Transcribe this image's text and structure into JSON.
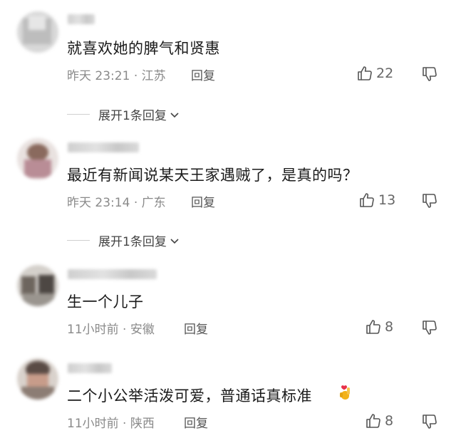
{
  "comments": [
    {
      "text": "就喜欢她的脾气和贤惠",
      "time": "昨天 23:21",
      "location": "江苏",
      "reply_label": "回复",
      "likes": "22",
      "expand_label": "展开1条回复"
    },
    {
      "text": "最近有新闻说某天王家遇贼了，是真的吗？",
      "time": "昨天 23:14",
      "location": "广东",
      "reply_label": "回复",
      "likes": "13",
      "expand_label": "展开1条回复"
    },
    {
      "text": "生一个儿子",
      "time": "11小时前",
      "location": "安徽",
      "reply_label": "回复",
      "likes": "8"
    },
    {
      "text": "二个小公举活泼可爱，普通话真标准",
      "time": "11小时前",
      "location": "陕西",
      "reply_label": "回复",
      "likes": "8",
      "emoji_icon": "finger-heart-emoji"
    }
  ],
  "meta_separator": "·",
  "colors": {
    "text_primary": "#1a1a1a",
    "text_secondary": "#8a8a8a",
    "icon": "#555555",
    "emoji": "#f2b21a"
  }
}
